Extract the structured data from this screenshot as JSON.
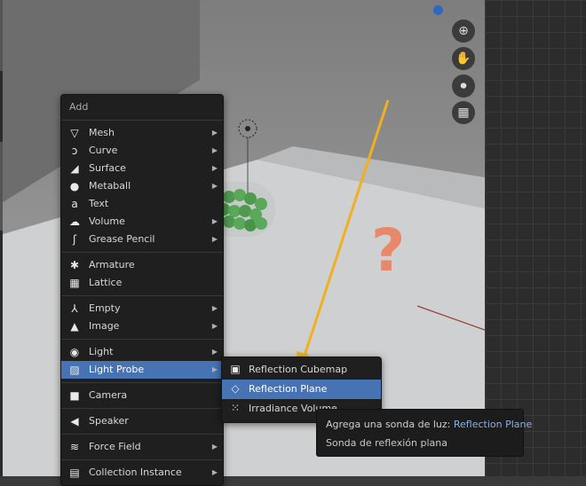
{
  "menu": {
    "title": "Add",
    "groups": [
      [
        {
          "label": "Mesh",
          "icon": "mesh-icon",
          "submenu": true
        },
        {
          "label": "Curve",
          "icon": "curve-icon",
          "submenu": true
        },
        {
          "label": "Surface",
          "icon": "surface-icon",
          "submenu": true
        },
        {
          "label": "Metaball",
          "icon": "metaball-icon",
          "submenu": true
        },
        {
          "label": "Text",
          "icon": "text-icon",
          "submenu": false
        },
        {
          "label": "Volume",
          "icon": "volume-icon",
          "submenu": true
        },
        {
          "label": "Grease Pencil",
          "icon": "grease-pencil-icon",
          "submenu": true
        }
      ],
      [
        {
          "label": "Armature",
          "icon": "armature-icon",
          "submenu": false
        },
        {
          "label": "Lattice",
          "icon": "lattice-icon",
          "submenu": false
        }
      ],
      [
        {
          "label": "Empty",
          "icon": "empty-icon",
          "submenu": true
        },
        {
          "label": "Image",
          "icon": "image-icon",
          "submenu": true
        }
      ],
      [
        {
          "label": "Light",
          "icon": "light-icon",
          "submenu": true
        },
        {
          "label": "Light Probe",
          "icon": "light-probe-icon",
          "submenu": true,
          "active": true
        }
      ],
      [
        {
          "label": "Camera",
          "icon": "camera-icon",
          "submenu": false
        }
      ],
      [
        {
          "label": "Speaker",
          "icon": "speaker-icon",
          "submenu": false
        }
      ],
      [
        {
          "label": "Force Field",
          "icon": "force-field-icon",
          "submenu": true
        }
      ],
      [
        {
          "label": "Collection Instance",
          "icon": "collection-icon",
          "submenu": true
        }
      ]
    ]
  },
  "submenu": {
    "items": [
      {
        "label": "Reflection Cubemap",
        "icon": "reflection-cubemap-icon"
      },
      {
        "label": "Reflection Plane",
        "icon": "reflection-plane-icon",
        "active": true
      },
      {
        "label": "Irradiance Volume",
        "icon": "irradiance-volume-icon"
      }
    ]
  },
  "tooltip": {
    "line1_prefix": "Agrega una sonda de luz:",
    "line1_highlight": "Reflection Plane",
    "line2": "Sonda de reflexión plana"
  },
  "annotation": {
    "question_mark": "?",
    "arrow_color": "#f0b020",
    "question_color": "#e8876a"
  },
  "colors": {
    "accent": "#4772b3",
    "menu_bg": "#1f1f1f",
    "axis_blue": "#2f68c0"
  }
}
